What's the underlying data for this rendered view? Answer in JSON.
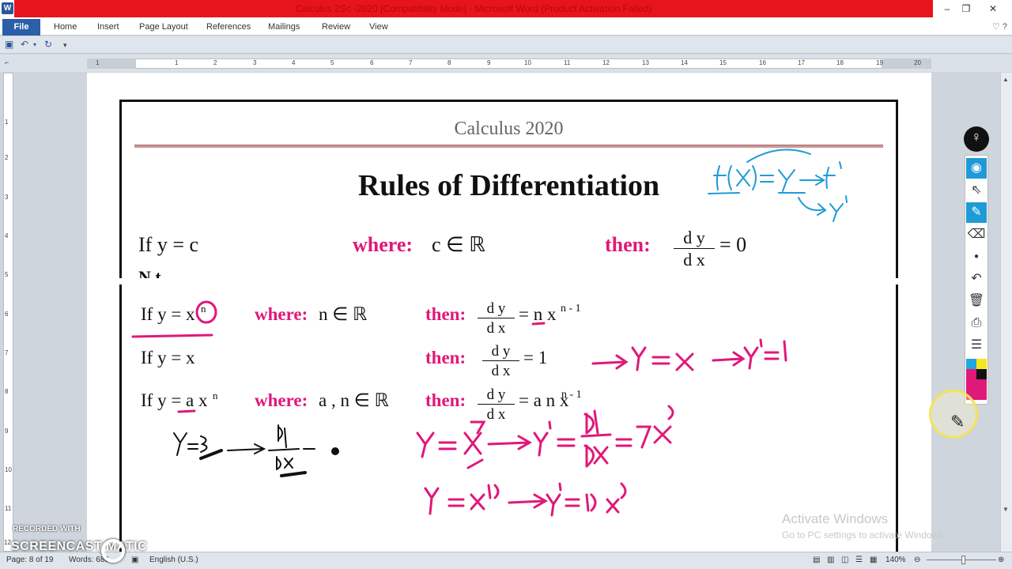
{
  "window": {
    "title": "Calculus 2Sc -2020 [Compatibility Mode] - Microsoft Word (Product Activation Failed)",
    "app_icon": "W",
    "minimize": "–",
    "restore": "❐",
    "close": "✕"
  },
  "ribbon": {
    "file_tab": "File",
    "tabs": [
      "Home",
      "Insert",
      "Page Layout",
      "References",
      "Mailings",
      "Review",
      "View"
    ],
    "help": "♡ ?",
    "minimize_ribbon": "⌄"
  },
  "ruler_numbers": [
    "1",
    "1",
    "2",
    "3",
    "4",
    "5",
    "6",
    "7",
    "8",
    "9",
    "10",
    "11",
    "12",
    "13",
    "14",
    "15",
    "16",
    "17",
    "18",
    "19",
    "20"
  ],
  "vruler_numbers": [
    "1",
    "2",
    "3",
    "4",
    "5",
    "6",
    "7",
    "8",
    "9",
    "10",
    "11",
    "12"
  ],
  "document": {
    "header": "Calculus 2020",
    "title": "Rules of Differentiation",
    "rule1": {
      "if": "If y = c",
      "where": "where:",
      "cond": "c ∈ ℝ",
      "then": "then:",
      "num": "d y",
      "den": "d x",
      "result": "= 0"
    },
    "note_clipped": "N t",
    "rule2": {
      "if": "If y = x",
      "exp": "n",
      "where": "where:",
      "cond": "n ∈ ℝ",
      "then": "then:",
      "num": "d y",
      "den": "d x",
      "result": "= n x",
      "result_exp": "n - 1"
    },
    "rule3": {
      "if": "If y = x",
      "then": "then:",
      "num": "d y",
      "den": "d x",
      "result": "= 1"
    },
    "rule4": {
      "if": "If y = a x",
      "exp": "n",
      "where": "where:",
      "cond": "a , n ∈ ℝ",
      "then": "then:",
      "num": "d y",
      "den": "d x",
      "result": "= a n x",
      "result_exp": "n - 1"
    }
  },
  "annotations": {
    "blue_note": "f(x) = y → f′ → y′",
    "pink_1": "→ y = x → y′ = 1",
    "pink_2": "y = x⁷ → y′ = dy/dx = 7x⁶",
    "pink_3": "y = x¹⁰ → y′ = 10x⁹",
    "black_note": "y = 3 → dy/dx = 0"
  },
  "status": {
    "page": "Page: 8 of 19",
    "words": "Words: 686",
    "language": "English (U.S.)",
    "zoom": "140%"
  },
  "overlay": {
    "activate_title": "Activate Windows",
    "activate_sub": "Go to PC settings to activate Windows.",
    "recorded_with": "RECORDED WITH",
    "brand": "SCREENCAST  MATIC"
  },
  "colors": {
    "accent_pink": "#e0187a",
    "ink_blue": "#1e9bd7",
    "title_red": "#e8141b"
  }
}
